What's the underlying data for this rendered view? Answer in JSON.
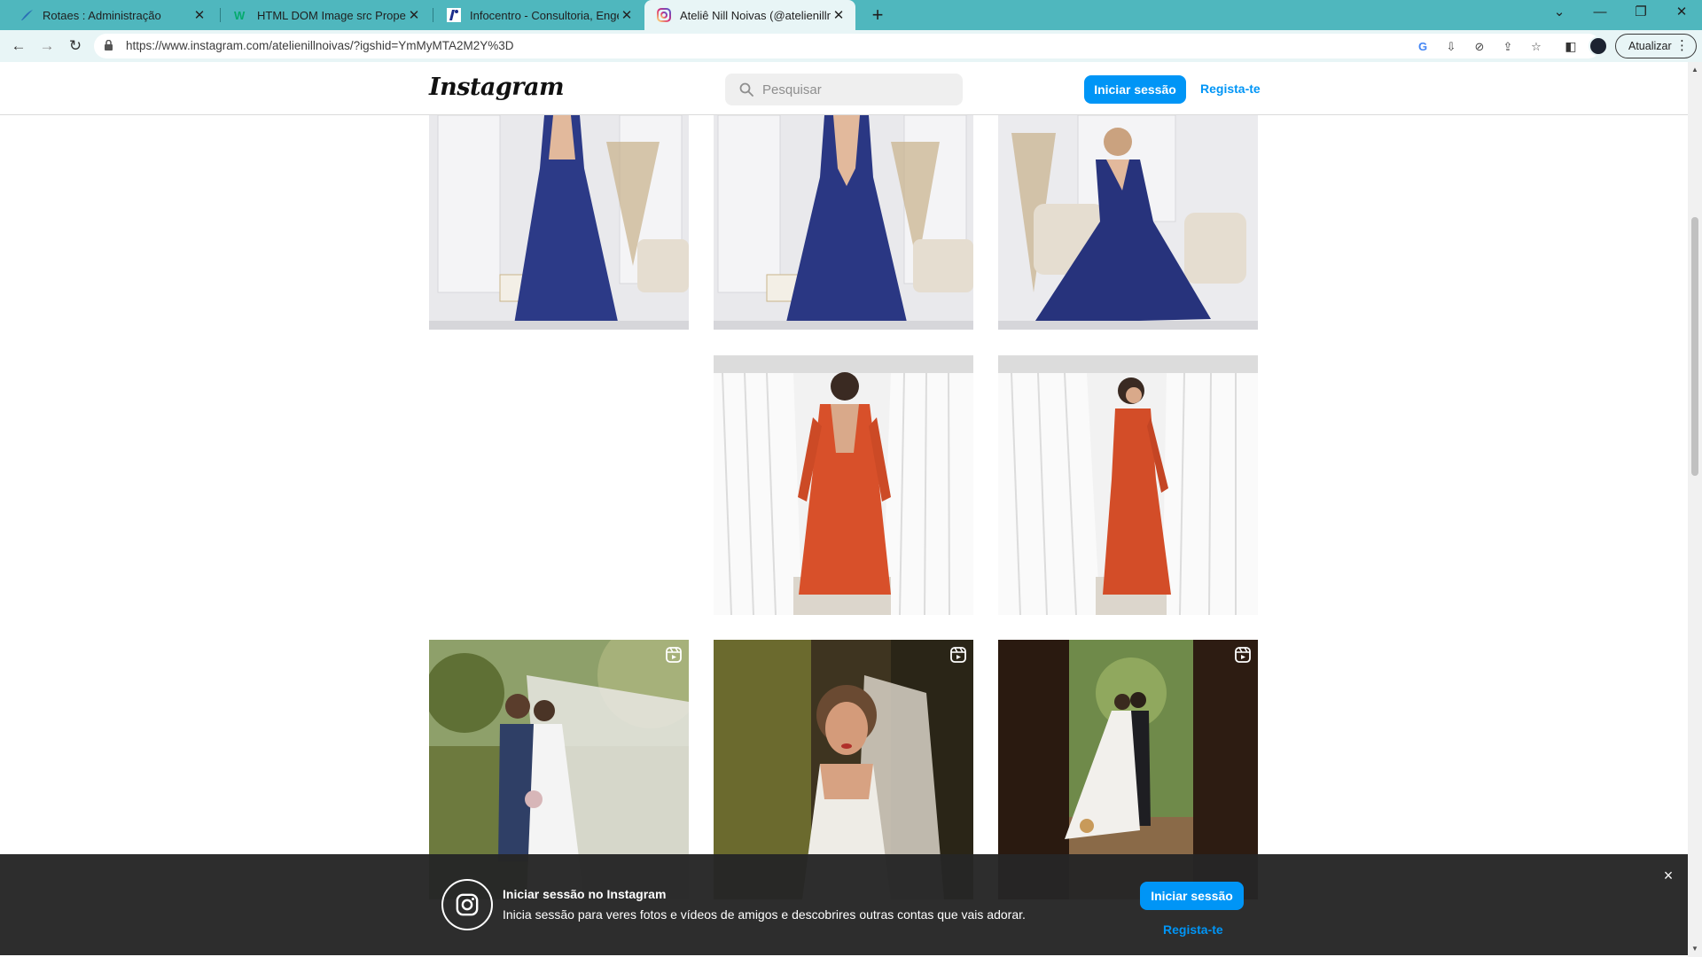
{
  "browser": {
    "tabs": [
      {
        "title": "Rotaes : Administração",
        "icon": "feather-favicon"
      },
      {
        "title": "HTML DOM Image src Property",
        "icon": "w3schools-favicon"
      },
      {
        "title": "Infocentro - Consultoria, Engenh",
        "icon": "infocentro-favicon"
      },
      {
        "title": "Ateliê Nill Noivas (@atelienillnoiv",
        "icon": "instagram-favicon",
        "active": true
      }
    ],
    "url": "https://www.instagram.com/atelienillnoivas/?igshid=YmMyMTA2M2Y%3D",
    "update_label": "Atualizar",
    "window_controls": [
      "chevron-down-icon",
      "minimize-icon",
      "restore-icon",
      "close-icon"
    ]
  },
  "instagram": {
    "logo": "Instagram",
    "search_placeholder": "Pesquisar",
    "login_label": "Iniciar sessão",
    "signup_label": "Regista-te"
  },
  "grid": {
    "rows": [
      [
        {
          "subject": "blue-gown-front",
          "reel": false
        },
        {
          "subject": "blue-gown-back",
          "reel": false
        },
        {
          "subject": "blue-gown-seated",
          "reel": false
        }
      ],
      [
        {
          "subject": "empty",
          "reel": false
        },
        {
          "subject": "orange-gown-back",
          "reel": false
        },
        {
          "subject": "orange-gown-side",
          "reel": false
        }
      ],
      [
        {
          "subject": "wedding-couple-veil",
          "reel": true
        },
        {
          "subject": "bride-portrait",
          "reel": true
        },
        {
          "subject": "wedding-couple-arch",
          "reel": true
        }
      ]
    ]
  },
  "banner": {
    "title": "Iniciar sessão no Instagram",
    "text": "Inicia sessão para veres fotos e vídeos de amigos e descobrires outras contas que vais adorar.",
    "login_label": "Iniciar sessão",
    "signup_label": "Regista-te",
    "close_symbol": "×"
  }
}
